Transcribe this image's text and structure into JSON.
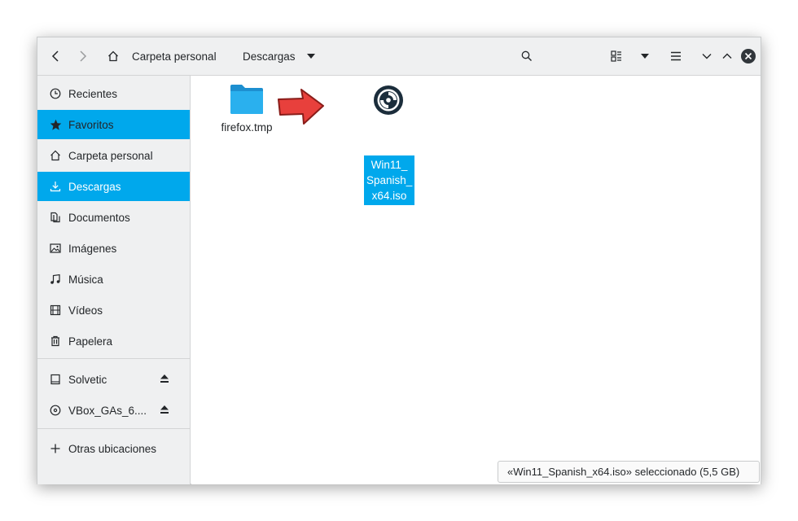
{
  "header": {
    "back_icon": "chevron-left-icon",
    "forward_icon": "chevron-right-icon",
    "home_icon": "home-icon",
    "path": [
      {
        "label": "Carpeta personal"
      },
      {
        "label": "Descargas"
      }
    ],
    "buttons": [
      "search-icon",
      "view-grid-icon",
      "caret-down-icon",
      "hamburger-menu-icon",
      "minimize-icon",
      "maximize-icon",
      "close-icon"
    ]
  },
  "sidebar": {
    "places": [
      {
        "label": "Recientes",
        "icon": "clock-icon",
        "active": false
      },
      {
        "label": "Favoritos",
        "icon": "star-icon",
        "active": true
      },
      {
        "label": "Carpeta personal",
        "icon": "home-icon",
        "active": false
      },
      {
        "label": "Descargas",
        "icon": "download-icon",
        "active": true
      },
      {
        "label": "Documentos",
        "icon": "documents-icon",
        "active": false
      },
      {
        "label": "Imágenes",
        "icon": "image-icon",
        "active": false
      },
      {
        "label": "Música",
        "icon": "music-icon",
        "active": false
      },
      {
        "label": "Vídeos",
        "icon": "video-icon",
        "active": false
      },
      {
        "label": "Papelera",
        "icon": "trash-icon",
        "active": false
      }
    ],
    "devices": [
      {
        "label": "Solvetic",
        "icon": "drive-icon",
        "eject": "eject-icon"
      },
      {
        "label": "VBox_GAs_6....",
        "icon": "disc-icon",
        "eject": "eject-icon"
      }
    ],
    "other": {
      "label": "Otras ubicaciones",
      "icon": "plus-icon"
    }
  },
  "files": [
    {
      "name": "firefox.tmp",
      "icon": "folder-icon",
      "selected": false
    },
    {
      "name": "Win11_Spanish_x64.iso",
      "name_lines": [
        "Win11_",
        "Spanish_",
        "x64.iso"
      ],
      "icon": "disc-image-icon",
      "selected": true
    }
  ],
  "status": {
    "text": "«Win11_Spanish_x64.iso» seleccionado (5,5 GB)"
  },
  "colors": {
    "accent": "#00a8ec",
    "folder": "#1fa5e6",
    "arrow": "#e8403c"
  }
}
